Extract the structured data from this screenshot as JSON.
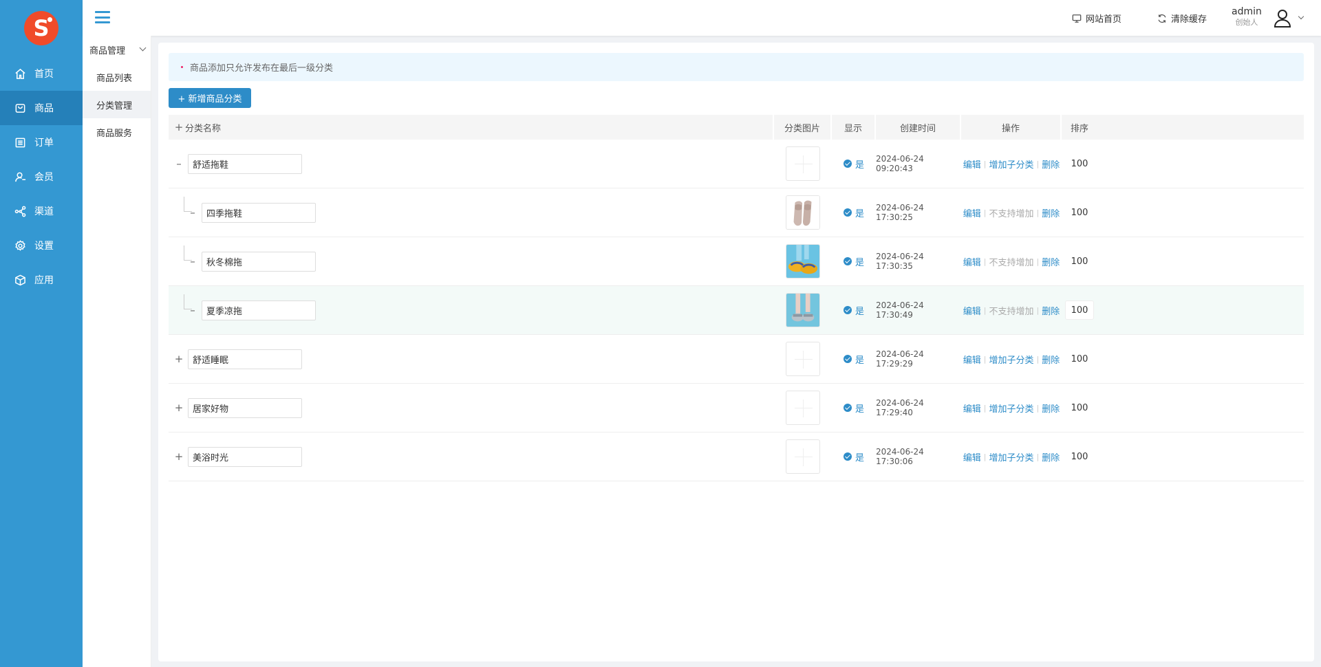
{
  "app": {
    "logo_letter": "S",
    "brand_color": "#3498d2",
    "logo_color": "#f04b2a"
  },
  "nav": [
    {
      "label": "首页",
      "icon": "home-icon"
    },
    {
      "label": "商品",
      "icon": "bag-icon",
      "active": true
    },
    {
      "label": "订单",
      "icon": "list-icon"
    },
    {
      "label": "会员",
      "icon": "user-icon"
    },
    {
      "label": "渠道",
      "icon": "share-icon"
    },
    {
      "label": "设置",
      "icon": "gear-icon"
    },
    {
      "label": "应用",
      "icon": "cube-icon"
    }
  ],
  "subnav": {
    "group": "商品管理",
    "items": [
      {
        "label": "商品列表"
      },
      {
        "label": "分类管理",
        "active": true
      },
      {
        "label": "商品服务"
      }
    ]
  },
  "header": {
    "site_home": "网站首页",
    "clear_cache": "清除缓存",
    "user_name": "admin",
    "user_role": "创始人"
  },
  "notice": "商品添加只允许发布在最后一级分类",
  "add_button": "+ 新增商品分类",
  "table": {
    "columns": {
      "expand": "+",
      "name": "分类名称",
      "image": "分类图片",
      "show": "显示",
      "created": "创建时间",
      "ops": "操作",
      "sort": "排序"
    },
    "rows": [
      {
        "level": 0,
        "toggle": "–",
        "name": "舒适拖鞋",
        "image": "none",
        "show": "是",
        "created": "2024-06-24 09:20:43",
        "op1": "编辑",
        "op2": "增加子分类",
        "op2_enabled": true,
        "op3": "删除",
        "sort": "100"
      },
      {
        "level": 1,
        "toggle": "–",
        "name": "四季拖鞋",
        "image": "beige-slippers",
        "show": "是",
        "created": "2024-06-24 17:30:25",
        "op1": "编辑",
        "op2": "不支持增加",
        "op2_enabled": false,
        "op3": "删除",
        "sort": "100"
      },
      {
        "level": 1,
        "toggle": "–",
        "name": "秋冬棉拖",
        "image": "yellow-slippers",
        "show": "是",
        "created": "2024-06-24 17:30:35",
        "op1": "编辑",
        "op2": "不支持增加",
        "op2_enabled": false,
        "op3": "删除",
        "sort": "100"
      },
      {
        "level": 1,
        "toggle": "–",
        "name": "夏季凉拖",
        "image": "sandals-on-feet",
        "show": "是",
        "created": "2024-06-24 17:30:49",
        "op1": "编辑",
        "op2": "不支持增加",
        "op2_enabled": false,
        "op3": "删除",
        "sort": "100",
        "highlight": true
      },
      {
        "level": 0,
        "toggle": "+",
        "name": "舒适睡眠",
        "image": "none",
        "show": "是",
        "created": "2024-06-24 17:29:29",
        "op1": "编辑",
        "op2": "增加子分类",
        "op2_enabled": true,
        "op3": "删除",
        "sort": "100"
      },
      {
        "level": 0,
        "toggle": "+",
        "name": "居家好物",
        "image": "none",
        "show": "是",
        "created": "2024-06-24 17:29:40",
        "op1": "编辑",
        "op2": "增加子分类",
        "op2_enabled": true,
        "op3": "删除",
        "sort": "100"
      },
      {
        "level": 0,
        "toggle": "+",
        "name": "美浴时光",
        "image": "none",
        "show": "是",
        "created": "2024-06-24 17:30:06",
        "op1": "编辑",
        "op2": "增加子分类",
        "op2_enabled": true,
        "op3": "删除",
        "sort": "100"
      }
    ]
  }
}
